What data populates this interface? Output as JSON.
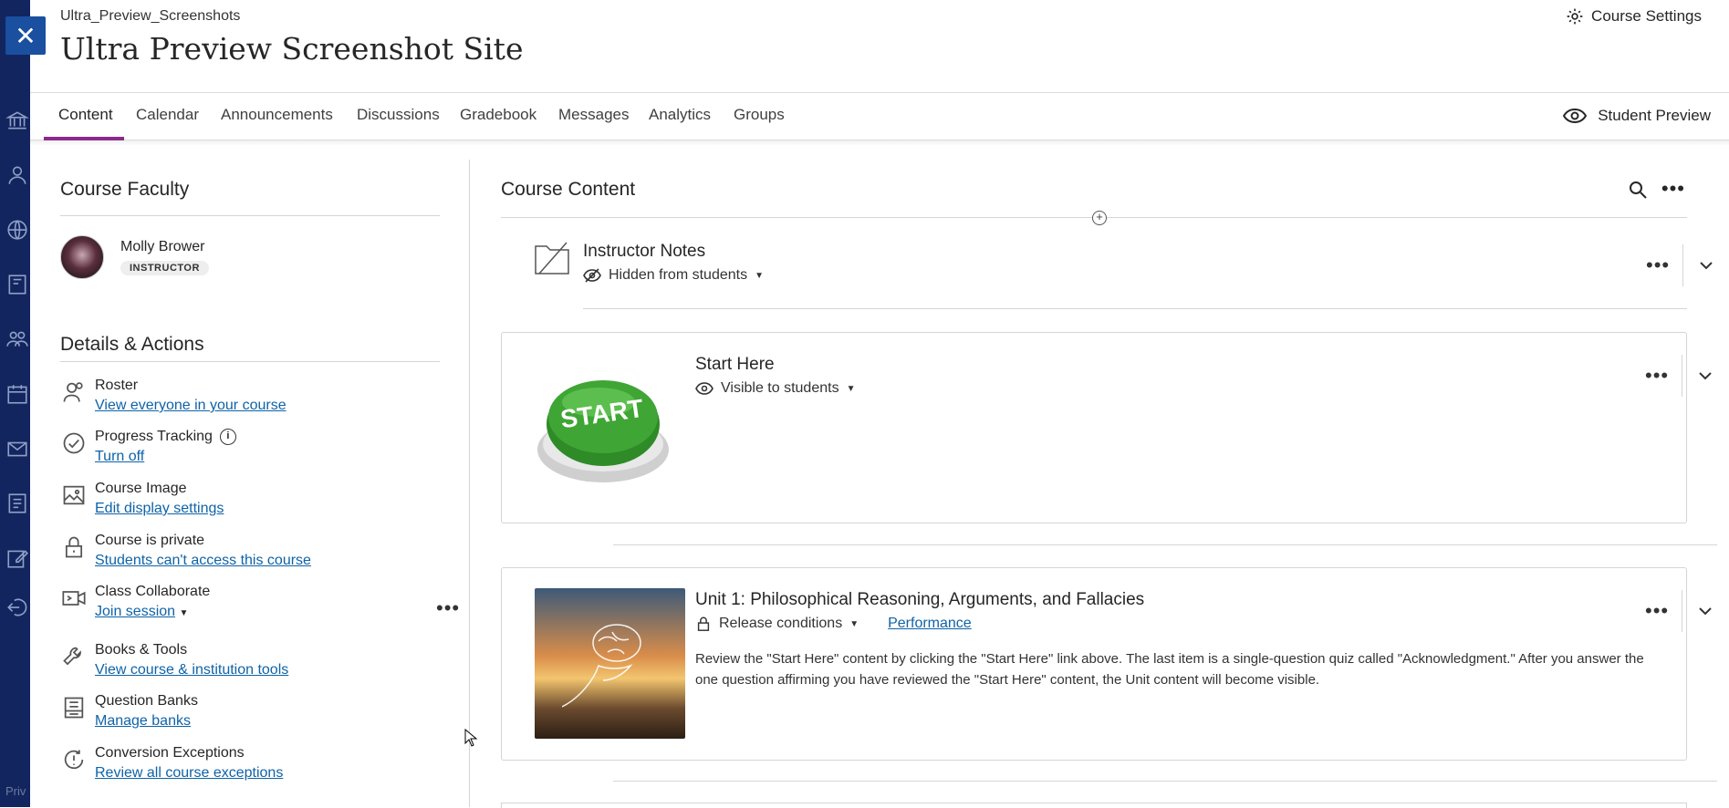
{
  "app": {
    "breadcrumb": "Ultra_Preview_Screenshots",
    "site_title": "Ultra Preview Screenshot Site",
    "course_settings_label": "Course Settings",
    "close_glyph": "✕",
    "rail_footer": "Priv"
  },
  "tabs": [
    {
      "label": "Content",
      "active": true
    },
    {
      "label": "Calendar"
    },
    {
      "label": "Announcements"
    },
    {
      "label": "Discussions"
    },
    {
      "label": "Gradebook"
    },
    {
      "label": "Messages"
    },
    {
      "label": "Analytics"
    },
    {
      "label": "Groups"
    }
  ],
  "student_preview_label": "Student Preview",
  "faculty": {
    "title": "Course Faculty",
    "name": "Molly Brower",
    "role": "INSTRUCTOR"
  },
  "details": {
    "title": "Details & Actions",
    "items": [
      {
        "label": "Roster",
        "link": "View everyone in your course",
        "icon": "roster-icon"
      },
      {
        "label": "Progress Tracking",
        "link": "Turn off",
        "icon": "check-circle-icon",
        "info": "i"
      },
      {
        "label": "Course Image",
        "link": "Edit display settings",
        "icon": "image-icon"
      },
      {
        "label": "Course is private",
        "link": "Students can't access this course",
        "icon": "lock-icon"
      },
      {
        "label": "Class Collaborate",
        "link": "Join session",
        "icon": "video-icon"
      },
      {
        "label": "Books & Tools",
        "link": "View course & institution tools",
        "icon": "wrench-icon"
      },
      {
        "label": "Question Banks",
        "link": "Manage banks",
        "icon": "question-bank-icon"
      },
      {
        "label": "Conversion Exceptions",
        "link": "Review all course exceptions",
        "icon": "exception-icon"
      }
    ]
  },
  "content": {
    "title": "Course Content",
    "items": [
      {
        "title": "Instructor Notes",
        "visibility": "Hidden from students",
        "icon": "folder-icon"
      },
      {
        "title": "Start Here",
        "visibility": "Visible to students",
        "image_text": "START"
      },
      {
        "title": "Unit 1: Philosophical Reasoning, Arguments, and Fallacies",
        "visibility": "Release conditions",
        "extra_link": "Performance",
        "description": "Review the \"Start Here\" content by clicking the \"Start Here\" link above. The last item is a single-question quiz called \"Acknowledgment.\" After you answer the one question affirming you have reviewed the \"Start Here\" content, the Unit content will become visible."
      }
    ]
  },
  "colors": {
    "rail": "#13255e",
    "link": "#0e63a8",
    "tab_underline": "#8c2a8c",
    "start_button": "#3fa535"
  }
}
